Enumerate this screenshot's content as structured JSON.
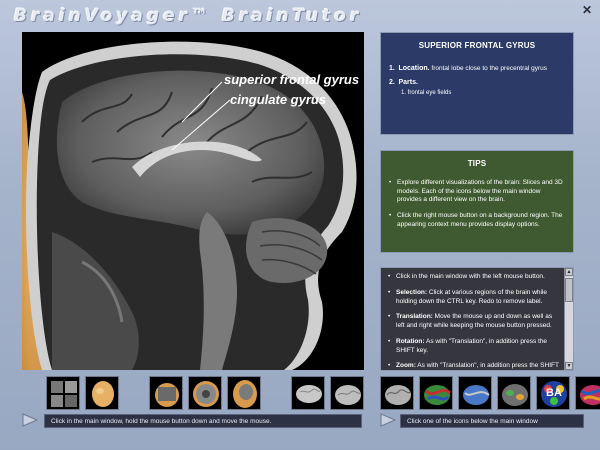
{
  "window": {
    "title": "BrainVoyager™ BrainTutor",
    "close_glyph": "✕"
  },
  "viewport": {
    "labels": [
      "superior frontal gyrus",
      "cingulate gyrus"
    ]
  },
  "info_panel": {
    "title": "SUPERIOR FRONTAL GYRUS",
    "items": [
      {
        "num": "1.",
        "key": "Location.",
        "text": "frontal lobe close to the precentral gyrus"
      },
      {
        "num": "2.",
        "key": "Parts.",
        "text": ""
      }
    ],
    "sub_items": [
      "1. frontal eye fields"
    ]
  },
  "tips_panel": {
    "title": "TIPS",
    "tips": [
      "Explore different visualizations of the brain: Slices and 3D models. Each of the icons below the main window provides a different view on the brain.",
      "Click the right mouse button on a background region. The appearing context menu provides display options."
    ],
    "color": "#3f5a30"
  },
  "help_panel": {
    "items": [
      {
        "key": "",
        "text": "Click in the main window with the left mouse button."
      },
      {
        "key": "Selection:",
        "text": " Click at various regions of the brain while holding down the CTRL key. Redo to remove label."
      },
      {
        "key": "Translation:",
        "text": " Move the mouse up and down as well as left and right while keeping the mouse button pressed."
      },
      {
        "key": "Rotation:",
        "text": " As with \"Translation\", in addition press the SHIFT key."
      },
      {
        "key": "Zoom:",
        "text": " As with \"Translation\", in addition press the SHIFT and CTRL key."
      }
    ]
  },
  "thumbnails_left": [
    "mri-slices-icon",
    "head-3d-icon",
    "head-cut-icon",
    "brain-slice-icon",
    "head-section-icon",
    "brain-gray-icon",
    "brain-gray-side-icon"
  ],
  "thumbnails_right": [
    "brain-surface-icon",
    "brain-color-icon",
    "brain-flat-icon",
    "brain-inflated-icon",
    "brodmann-area-icon",
    "brain-map-icon"
  ],
  "brodmann_label": "BA",
  "status": {
    "left": "Click in the main window, hold the mouse button down and move the mouse.",
    "right": "Click one of the icons below the main window"
  }
}
